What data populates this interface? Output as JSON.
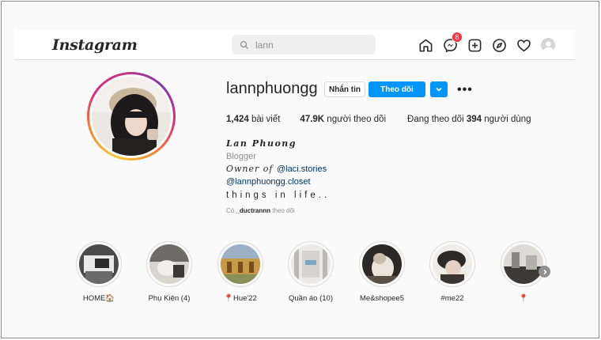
{
  "nav": {
    "logo": "Instagram",
    "search_placeholder": "lann",
    "messenger_badge": "8",
    "icons": [
      "home-icon",
      "messenger-icon",
      "new-post-icon",
      "explore-icon",
      "activity-heart-icon",
      "profile-avatar"
    ]
  },
  "profile": {
    "username": "lannphuongg",
    "buttons": {
      "message": "Nhắn tin",
      "follow": "Theo dõi"
    },
    "stats": {
      "posts_count": "1,424",
      "posts_label": " bài viết",
      "followers_count": "47.9K",
      "followers_label": " người theo dõi",
      "following_prefix": "Đang theo dõi ",
      "following_count": "394",
      "following_label": " người dùng"
    },
    "bio": {
      "full_name": "Lan Phuong",
      "category": "Blogger",
      "owner_text": "Owner of ",
      "owner_link": "@laci.stories",
      "closet_link": "@lannphuongg.closet",
      "tagline": "things in life..",
      "followed_by_prefix": "Có ",
      "followed_by_user": "_ductrannn",
      "followed_by_suffix": " theo dõi"
    }
  },
  "highlights": [
    {
      "label": "HOME🏠"
    },
    {
      "label": "Phụ Kiện (4)"
    },
    {
      "label": "📍Hue'22"
    },
    {
      "label": "Quần áo (10)"
    },
    {
      "label": "Me&shopee5"
    },
    {
      "label": "#me22"
    },
    {
      "label": "📍"
    }
  ],
  "colors": {
    "accent_blue": "#0095f6",
    "link_blue": "#00376b",
    "badge_red": "#ff3040",
    "background": "#fafafa"
  }
}
